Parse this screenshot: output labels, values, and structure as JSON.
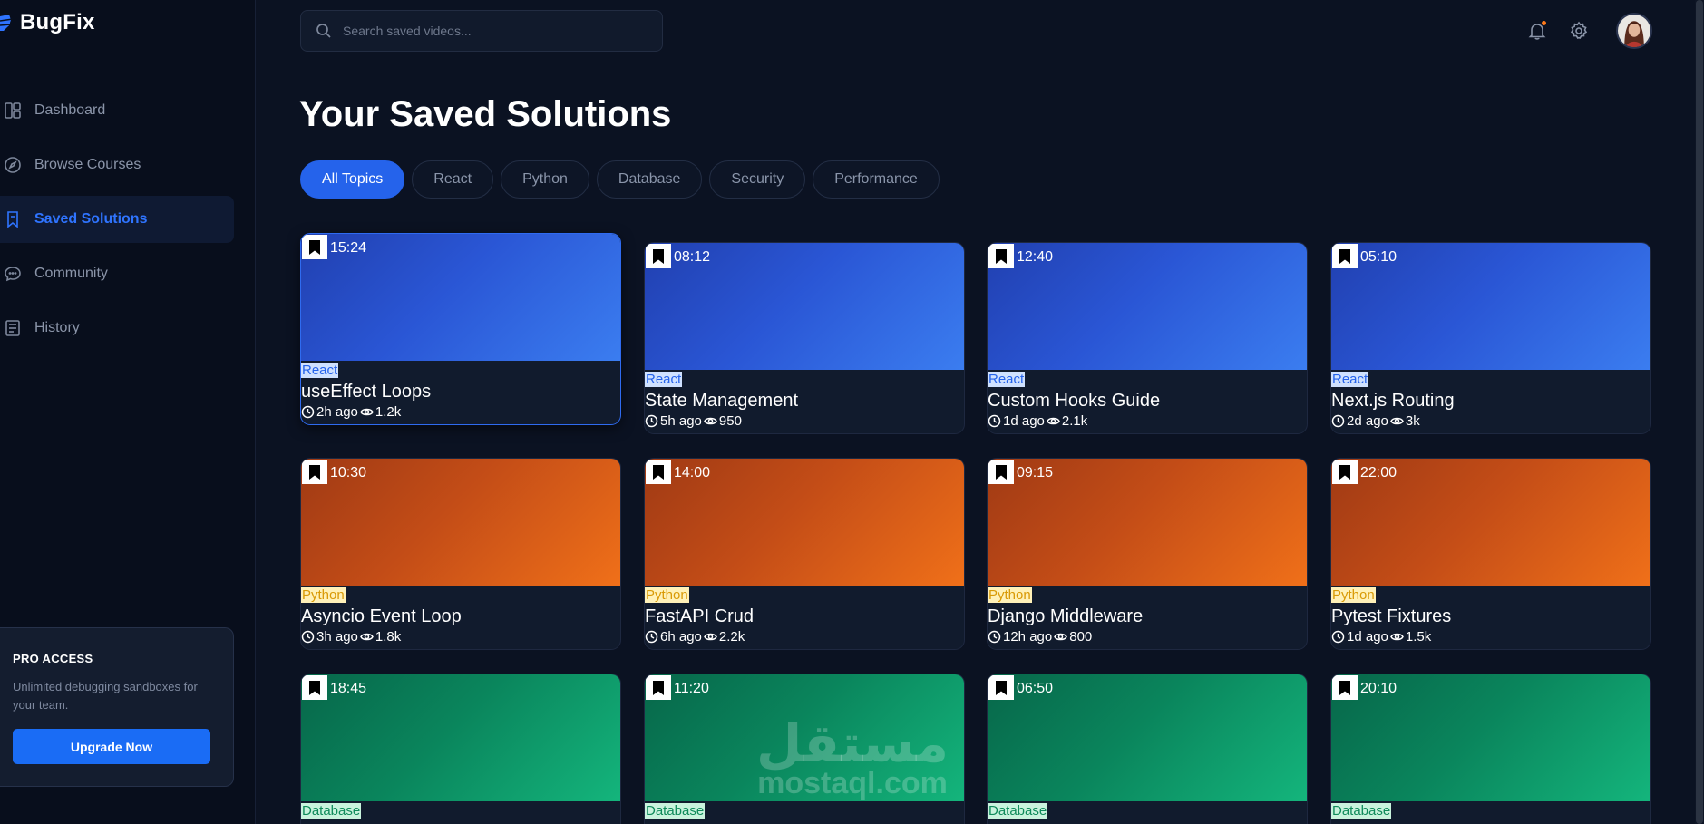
{
  "app": {
    "brand": "BugFix"
  },
  "sidebar": {
    "items": [
      {
        "label": "Dashboard",
        "icon": "dashboard-icon",
        "active": false
      },
      {
        "label": "Browse Courses",
        "icon": "compass-icon",
        "active": false
      },
      {
        "label": "Saved Solutions",
        "icon": "bookmark-icon",
        "active": true
      },
      {
        "label": "Community",
        "icon": "chat-icon",
        "active": false
      },
      {
        "label": "History",
        "icon": "history-icon",
        "active": false
      }
    ],
    "pro": {
      "title": "PRO ACCESS",
      "text": "Unlimited debugging sandboxes for your team.",
      "button": "Upgrade Now"
    }
  },
  "header": {
    "search_placeholder": "Search saved videos...",
    "icons": [
      "bell-icon",
      "gear-icon"
    ],
    "accent": "#2563eb"
  },
  "main": {
    "title": "Your Saved Solutions",
    "filters": [
      "All Topics",
      "React",
      "Python",
      "Database",
      "Security",
      "Performance"
    ],
    "active_filter": "All Topics",
    "cards": [
      {
        "duration": "15:24",
        "tag": "React",
        "title": "useEffect Loops",
        "time": "2h ago",
        "views": "1.2k"
      },
      {
        "duration": "08:12",
        "tag": "React",
        "title": "State Management",
        "time": "5h ago",
        "views": "950"
      },
      {
        "duration": "12:40",
        "tag": "React",
        "title": "Custom Hooks Guide",
        "time": "1d ago",
        "views": "2.1k"
      },
      {
        "duration": "05:10",
        "tag": "React",
        "title": "Next.js Routing",
        "time": "2d ago",
        "views": "3k"
      },
      {
        "duration": "10:30",
        "tag": "Python",
        "title": "Asyncio Event Loop",
        "time": "3h ago",
        "views": "1.8k"
      },
      {
        "duration": "14:00",
        "tag": "Python",
        "title": "FastAPI Crud",
        "time": "6h ago",
        "views": "2.2k"
      },
      {
        "duration": "09:15",
        "tag": "Python",
        "title": "Django Middleware",
        "time": "12h ago",
        "views": "800"
      },
      {
        "duration": "22:00",
        "tag": "Python",
        "title": "Pytest Fixtures",
        "time": "1d ago",
        "views": "1.5k"
      },
      {
        "duration": "18:45",
        "tag": "Database"
      },
      {
        "duration": "11:20",
        "tag": "Database"
      },
      {
        "duration": "06:50",
        "tag": "Database"
      },
      {
        "duration": "20:10",
        "tag": "Database"
      }
    ]
  },
  "watermark": {
    "arabic": "مستقل",
    "latin": "mostaql.com"
  }
}
